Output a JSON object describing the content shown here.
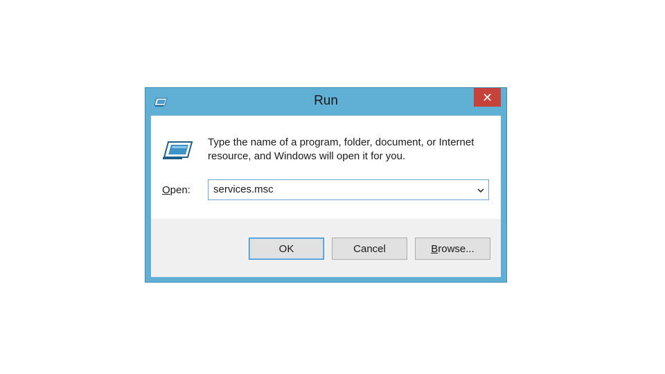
{
  "dialog": {
    "title": "Run",
    "close_glyph": "✕",
    "description": "Type the name of a program, folder, document, or Internet resource, and Windows will open it for you.",
    "open_label_accel": "O",
    "open_label_rest": "pen:",
    "combo_value": "services.msc",
    "buttons": {
      "ok": "OK",
      "cancel": "Cancel",
      "browse_accel": "B",
      "browse_rest": "rowse..."
    },
    "icons": {
      "title": "run-icon",
      "body": "run-icon",
      "dropdown": "chevron-down-icon",
      "close": "close-icon"
    },
    "colors": {
      "frame": "#5fb0d4",
      "close": "#c7423a",
      "footer": "#f0f0f0"
    }
  }
}
